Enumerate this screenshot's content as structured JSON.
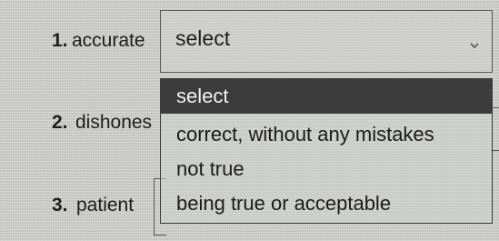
{
  "questions": [
    {
      "number": "1.",
      "word": "accurate"
    },
    {
      "number": "2.",
      "word": "dishones"
    },
    {
      "number": "3.",
      "word": "patient"
    }
  ],
  "select1": {
    "selected": "select",
    "open": true,
    "options": [
      "select",
      "correct, without any mistakes",
      "not true",
      "being true or acceptable"
    ],
    "highlighted_index": 0
  },
  "icons": {
    "dropdown_toggle": "chevron-down-icon"
  },
  "colors": {
    "highlight_bg": "#3c3c3c",
    "highlight_text": "#f2f2f2",
    "border": "#555a55"
  }
}
